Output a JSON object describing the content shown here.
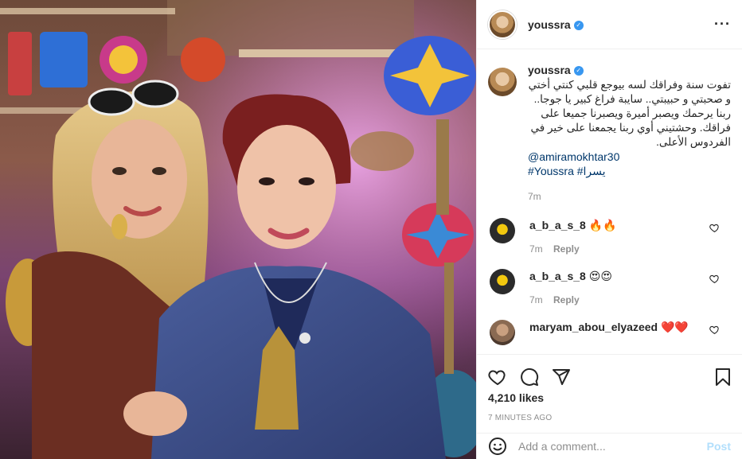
{
  "header": {
    "username": "youssra",
    "more_icon": "more-options-icon"
  },
  "caption": {
    "username": "youssra",
    "text": "تفوت سنة وفراقك لسه بيوجع قلبي كنتي أختي و صحبتي و حبيبتي.. سايبة فراغ كبير يا جوجا.. ربنا يرحمك ويصبر أميرة ويصبرنا جميعا على فراقك. وحشتيني أوي ربنا يجمعنا على خير في الفردوس الأعلى.",
    "mention": "@amiramokhtar30",
    "hashtags": "#Youssra #يسرا",
    "time": "7m"
  },
  "comments": [
    {
      "username": "a_b_a_s_8",
      "text": "🔥🔥",
      "time": "7m",
      "reply": "Reply"
    },
    {
      "username": "a_b_a_s_8",
      "text": "😍😍",
      "time": "7m",
      "reply": "Reply"
    },
    {
      "username": "maryam_abou_elyazeed",
      "text": "❤️❤️",
      "time": "",
      "reply": ""
    }
  ],
  "actions": {
    "likes": "4,210 likes",
    "time_ago": "7 MINUTES AGO"
  },
  "add_comment": {
    "placeholder": "Add a comment...",
    "post_label": "Post"
  },
  "colors": {
    "verified": "#3897f0",
    "link": "#00376b",
    "post_disabled": "#b2dffc",
    "secondary_text": "#8e8e8e"
  }
}
